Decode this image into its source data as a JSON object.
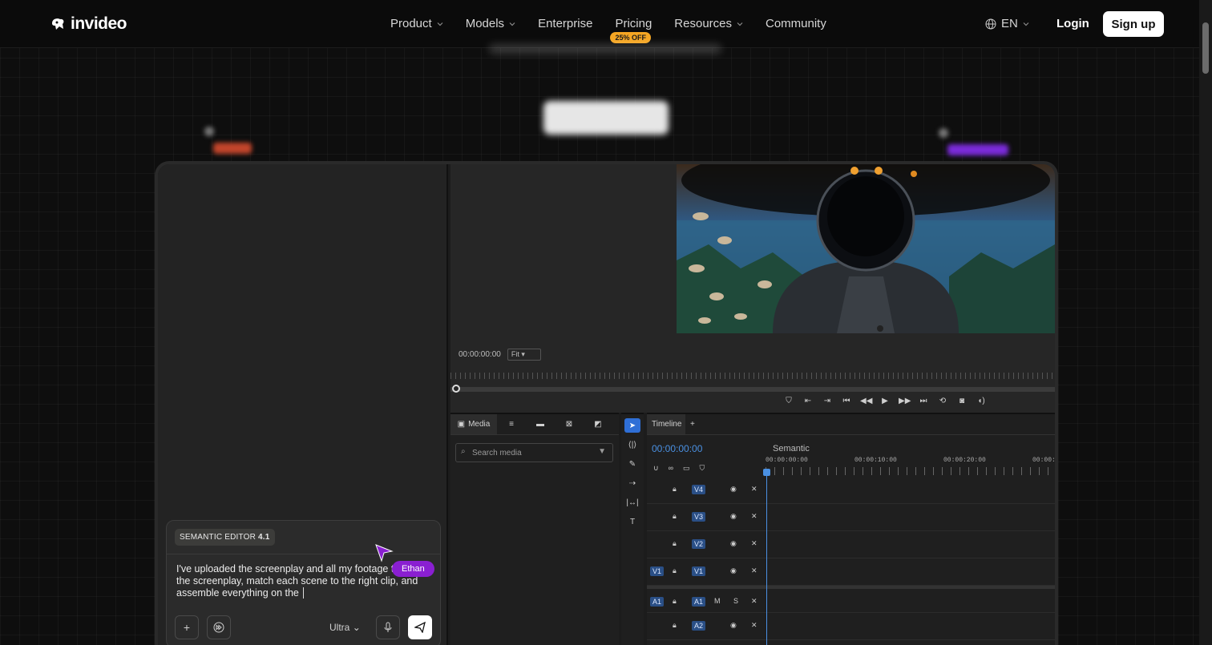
{
  "nav": {
    "brand": "invideo",
    "items": [
      {
        "label": "Product",
        "has_dropdown": true
      },
      {
        "label": "Models",
        "has_dropdown": true
      },
      {
        "label": "Enterprise",
        "has_dropdown": false
      },
      {
        "label": "Pricing",
        "has_dropdown": false,
        "badge": "25% OFF"
      },
      {
        "label": "Resources",
        "has_dropdown": true
      },
      {
        "label": "Community",
        "has_dropdown": false
      }
    ],
    "language": "EN",
    "login": "Login",
    "signup": "Sign up"
  },
  "colors": {
    "badge": "#f5a623",
    "accent_blue": "#4a90e2",
    "cursor_purple": "#8a1fd1"
  },
  "chat": {
    "tag_name": "SEMANTIC EDITOR",
    "tag_version": "4.1",
    "message": "I've uploaded the screenplay and all my footage through the screenplay, match each scene to the right clip, and assemble everything on the ",
    "model": "Ultra",
    "cursor_user": "Ethan"
  },
  "preview": {
    "timecode": "00:00:00:00",
    "fit": "Fit"
  },
  "media": {
    "tab_label": "Media",
    "search_placeholder": "Search media"
  },
  "timeline": {
    "tab_label": "Timeline",
    "add_tab": "+",
    "timecode": "00:00:00:00",
    "sequence_name": "Semantic",
    "ruler": [
      "00:00:00:00",
      "00:00:10:00",
      "00:00:20:00",
      "00:00:"
    ],
    "tracks": [
      {
        "label": "V4",
        "target": "",
        "kind": "video"
      },
      {
        "label": "V3",
        "target": "",
        "kind": "video"
      },
      {
        "label": "V2",
        "target": "",
        "kind": "video"
      },
      {
        "label": "V1",
        "target": "V1",
        "kind": "video"
      },
      {
        "label": "A1",
        "target": "A1",
        "kind": "audio",
        "m": "M",
        "s": "S"
      },
      {
        "label": "A2",
        "target": "",
        "kind": "audio2"
      }
    ]
  }
}
